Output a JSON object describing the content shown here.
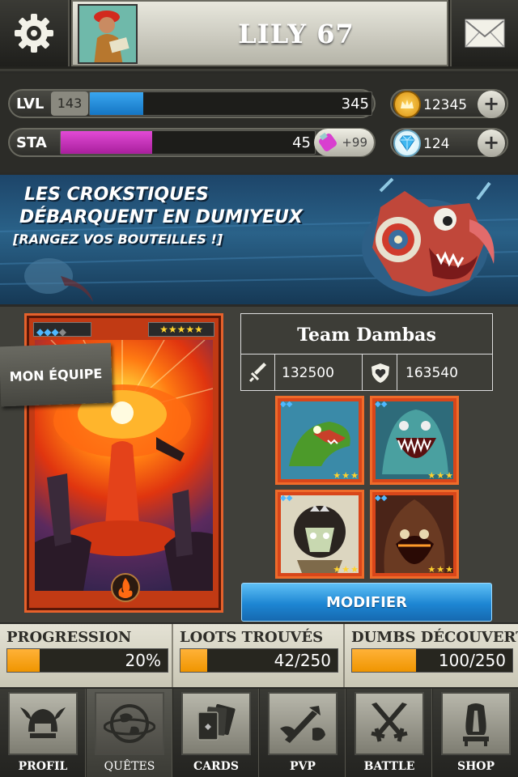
{
  "header": {
    "player_name": "LILY 67"
  },
  "stats": {
    "level_label": "LVL",
    "level_value": "143",
    "xp_value": "345",
    "xp_progress": 0.19,
    "stamina_label": "STA",
    "stamina_value": "45",
    "stamina_progress": 0.36,
    "potion_bonus": "+99",
    "gold": "12345",
    "gems": "124",
    "plus": "+"
  },
  "banner": {
    "line1": "LES CROKSTIQUES",
    "line2": "DÉBARQUENT EN DUMIYEUX",
    "line3": "[RANGEZ VOS BOUTEILLES !]"
  },
  "team": {
    "section_label": "MON ÉQUIPE",
    "name": "Team Dambas",
    "attack": "132500",
    "defense": "163540",
    "modify_button": "MODIFIER",
    "members": [
      {
        "stars": "★★★"
      },
      {
        "stars": "★★★"
      },
      {
        "stars": "★★★"
      },
      {
        "stars": "★★★"
      }
    ],
    "card_stars": "★★★★★"
  },
  "progress": [
    {
      "label": "PROGRESSION",
      "value": "20%",
      "fraction": 0.2
    },
    {
      "label": "LOOTS TROUVÉS",
      "value": "42/250",
      "fraction": 0.168
    },
    {
      "label": "DUMBS DÉCOUVERTS",
      "value": "100/250",
      "fraction": 0.4
    }
  ],
  "nav": [
    {
      "label": "PROFIL",
      "icon": "helmet-icon"
    },
    {
      "label": "QUÊTES",
      "icon": "globe-icon"
    },
    {
      "label": "CARDS",
      "icon": "cards-icon"
    },
    {
      "label": "PVP",
      "icon": "pvp-icon"
    },
    {
      "label": "BATTLE",
      "icon": "crossed-swords-icon"
    },
    {
      "label": "SHOP",
      "icon": "shop-icon"
    }
  ],
  "colors": {
    "xp_bar": "#1f86d6",
    "stamina_bar": "#c42bb8",
    "progress_bar": "#f7a51e",
    "modify_button": "#1d86d3"
  }
}
